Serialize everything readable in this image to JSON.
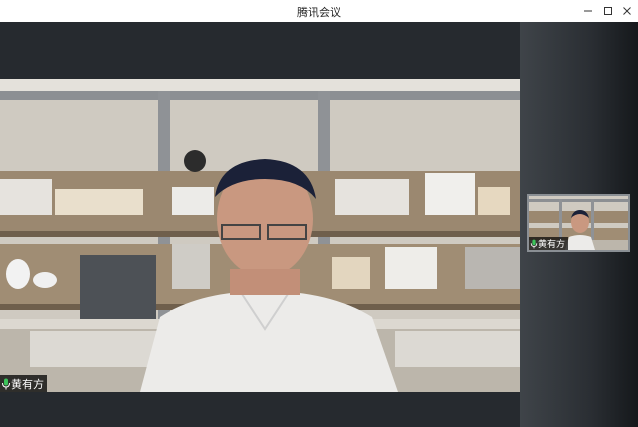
{
  "window": {
    "title": "腾讯会议",
    "minimize_icon": "minimize-icon",
    "maximize_icon": "maximize-icon",
    "close_icon": "close-icon"
  },
  "main_video": {
    "participant_name": "黄有方",
    "mic_icon": "microphone-icon",
    "mic_color": "#3cc35a"
  },
  "thumbnail": {
    "participant_name": "黄有方",
    "mic_icon": "microphone-icon",
    "mic_color": "#3cc35a"
  }
}
